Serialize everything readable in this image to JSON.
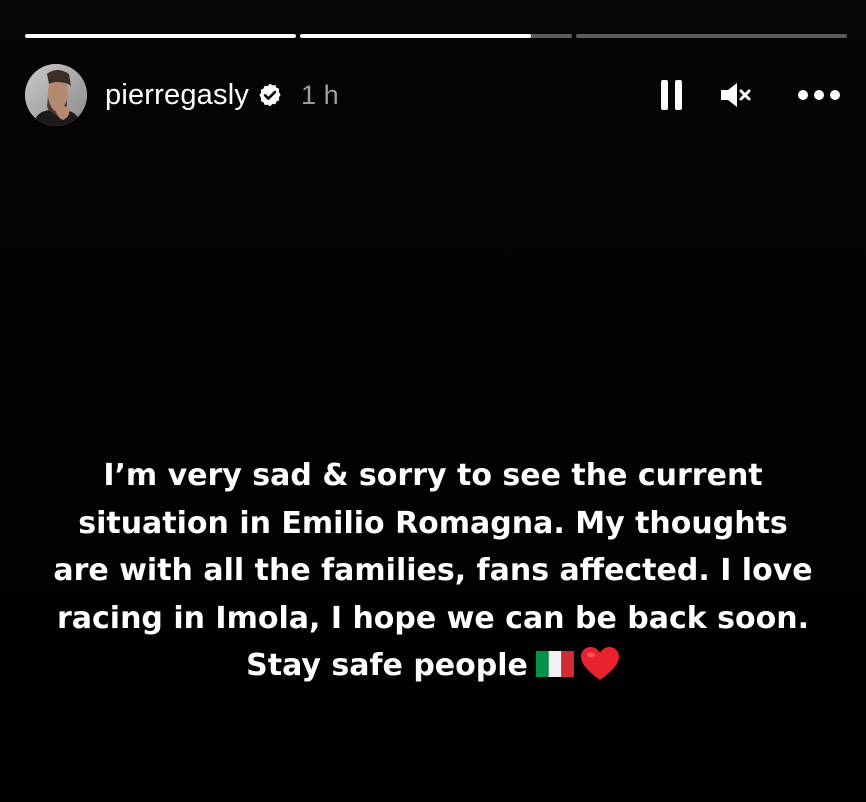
{
  "story": {
    "progress": [
      {
        "fill_fraction": 1.0
      },
      {
        "fill_fraction": 0.85
      },
      {
        "fill_fraction": 0.0
      }
    ],
    "user": {
      "username": "pierregasly",
      "verified": true,
      "time_ago": "1 h"
    },
    "controls": {
      "pause_icon": "pause-icon",
      "mute_icon": "speaker-muted-icon",
      "more_icon": "more-dots-icon"
    },
    "caption": {
      "lines": [
        "I’m very sad & sorry to see the current",
        "situation in Emilio Romagna. My thoughts",
        "are with all the families, fans affected. I love",
        "racing in Imola, I hope we can be back soon.",
        "Stay safe people"
      ],
      "emojis": [
        "italy-flag-emoji",
        "red-heart-emoji"
      ]
    },
    "colors": {
      "background": "#000000",
      "text": "#ffffff",
      "progress_track": "rgba(255,255,255,0.35)",
      "progress_fill": "#ffffff",
      "heart": "#e8232f",
      "flag_green": "#009246",
      "flag_white": "#f1f2f1",
      "flag_red": "#ce2b37"
    }
  }
}
